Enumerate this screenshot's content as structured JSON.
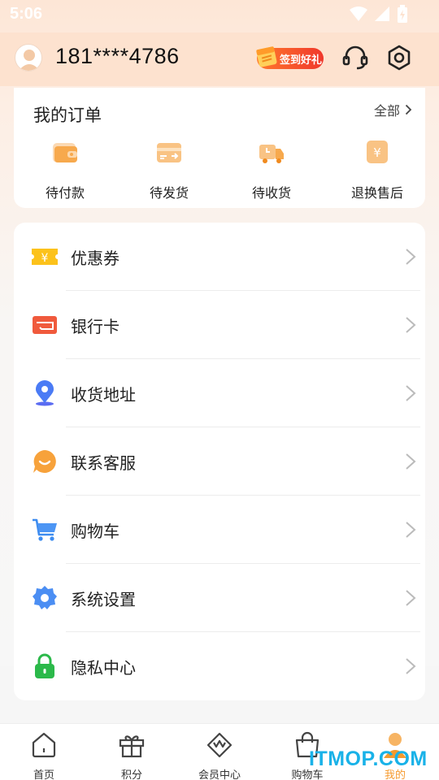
{
  "status": {
    "time": "5:06"
  },
  "header": {
    "phone": "181****4786",
    "signin_label": "签到好礼"
  },
  "orders": {
    "title": "我的订单",
    "all_label": "全部",
    "items": [
      {
        "label": "待付款",
        "icon": "wallet-icon"
      },
      {
        "label": "待发货",
        "icon": "card-ship-icon"
      },
      {
        "label": "待收货",
        "icon": "truck-icon"
      },
      {
        "label": "退换售后",
        "icon": "refund-icon"
      }
    ]
  },
  "menu": {
    "items": [
      {
        "label": "优惠券",
        "icon": "coupon-icon"
      },
      {
        "label": "银行卡",
        "icon": "bank-card-icon"
      },
      {
        "label": "收货地址",
        "icon": "location-pin-icon"
      },
      {
        "label": "联系客服",
        "icon": "chat-bubble-icon"
      },
      {
        "label": "购物车",
        "icon": "shopping-cart-icon"
      },
      {
        "label": "系统设置",
        "icon": "settings-gear-icon"
      },
      {
        "label": "隐私中心",
        "icon": "lock-icon"
      }
    ]
  },
  "tabbar": {
    "items": [
      {
        "label": "首页",
        "icon": "home-icon"
      },
      {
        "label": "积分",
        "icon": "gift-icon"
      },
      {
        "label": "会员中心",
        "icon": "crown-icon"
      },
      {
        "label": "购物车",
        "icon": "shopping-bag-icon"
      },
      {
        "label": "我的",
        "icon": "user-icon",
        "active": true
      }
    ]
  },
  "watermark": "ITMOP.COM",
  "colors": {
    "accent": "#f59a2e",
    "header_bg": "#fde2cf",
    "signin_red": "#f0372b",
    "watermark": "#19b2e8"
  }
}
